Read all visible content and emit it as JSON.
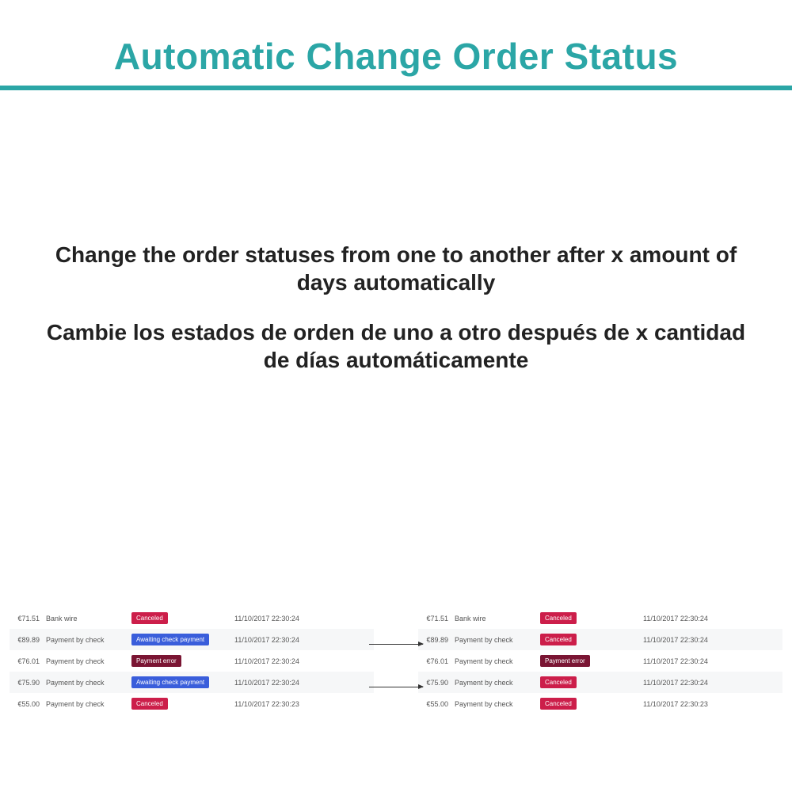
{
  "header": {
    "title": "Automatic Change Order Status"
  },
  "description": {
    "en": "Change the order statuses from one to another after x amount of days automatically",
    "es": "Cambie los estados de orden de uno a otro después de x cantidad de días automáticamente"
  },
  "status_labels": {
    "canceled": "Canceled",
    "awaiting": "Awaiting check payment",
    "error": "Payment error"
  },
  "left_table": [
    {
      "price": "€71.51",
      "method": "Bank wire",
      "status": "canceled",
      "date": "11/10/2017 22:30:24"
    },
    {
      "price": "€89.89",
      "method": "Payment by check",
      "status": "awaiting",
      "date": "11/10/2017 22:30:24"
    },
    {
      "price": "€76.01",
      "method": "Payment by check",
      "status": "error",
      "date": "11/10/2017 22:30:24"
    },
    {
      "price": "€75.90",
      "method": "Payment by check",
      "status": "awaiting",
      "date": "11/10/2017 22:30:24"
    },
    {
      "price": "€55.00",
      "method": "Payment by check",
      "status": "canceled",
      "date": "11/10/2017 22:30:23"
    }
  ],
  "right_table": [
    {
      "price": "€71.51",
      "method": "Bank wire",
      "status": "canceled",
      "date": "11/10/2017 22:30:24"
    },
    {
      "price": "€89.89",
      "method": "Payment by check",
      "status": "canceled",
      "date": "11/10/2017 22:30:24"
    },
    {
      "price": "€76.01",
      "method": "Payment by check",
      "status": "error",
      "date": "11/10/2017 22:30:24"
    },
    {
      "price": "€75.90",
      "method": "Payment by check",
      "status": "canceled",
      "date": "11/10/2017 22:30:24"
    },
    {
      "price": "€55.00",
      "method": "Payment by check",
      "status": "canceled",
      "date": "11/10/2017 22:30:23"
    }
  ]
}
